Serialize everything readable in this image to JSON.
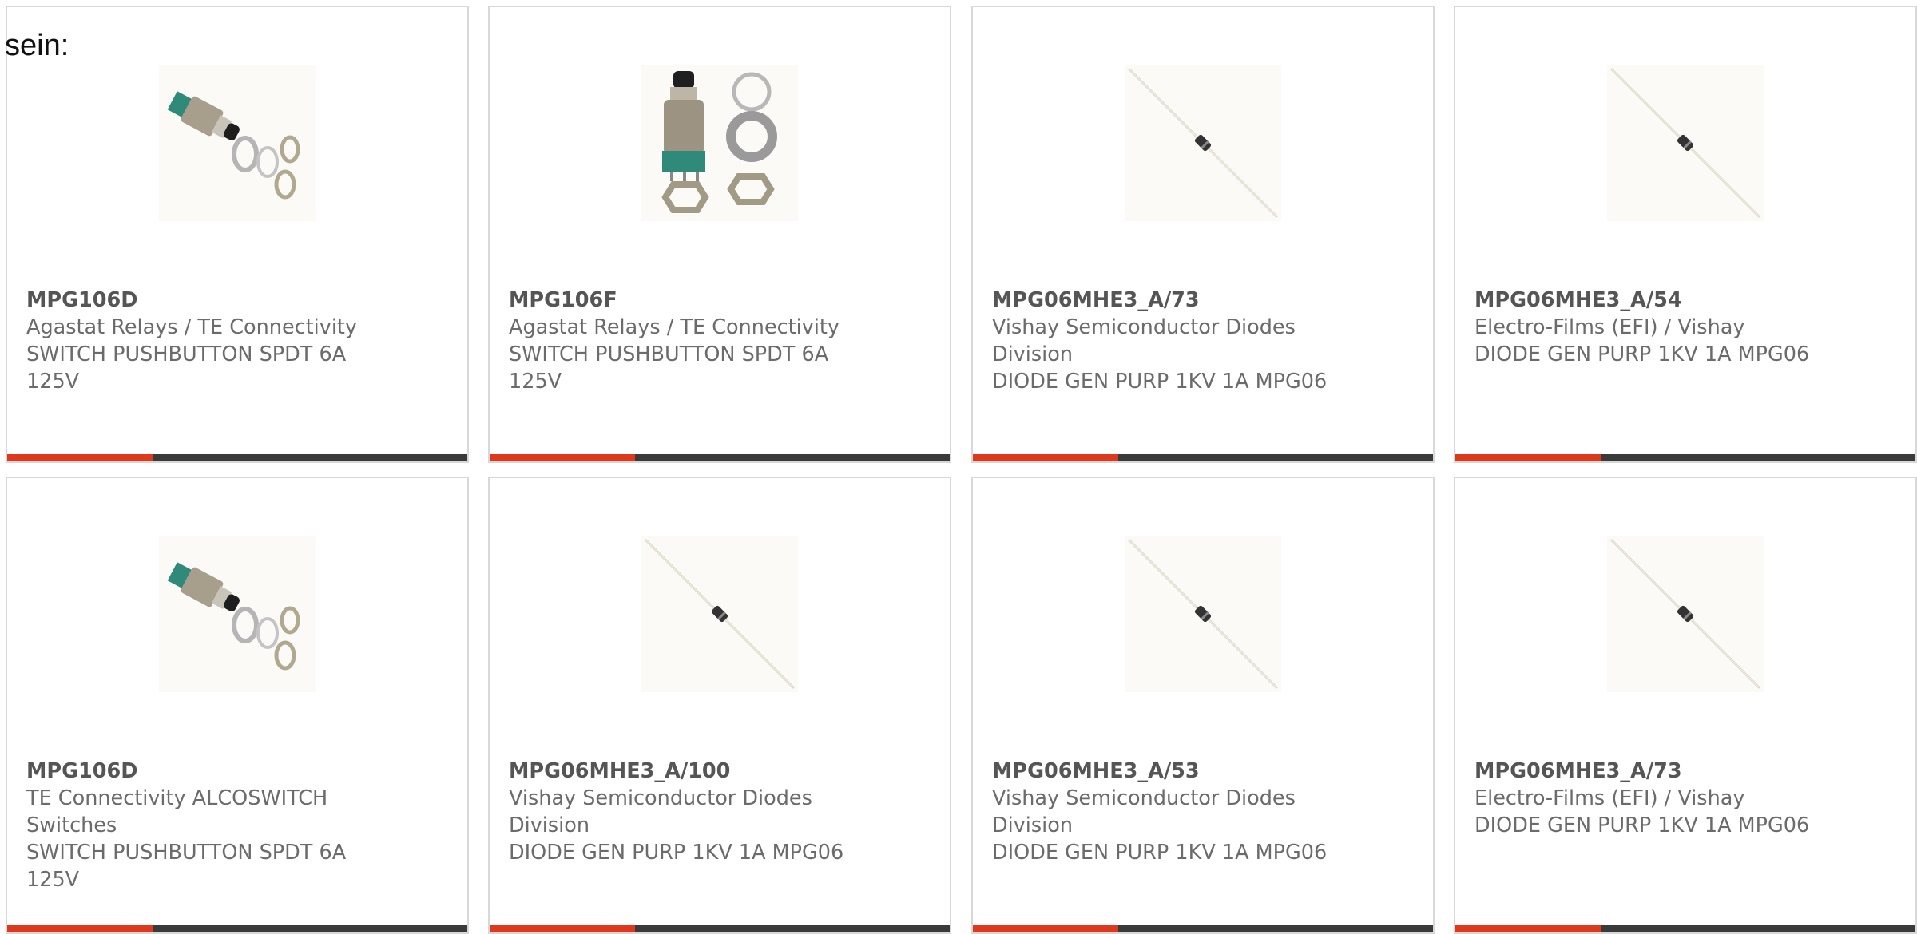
{
  "page": {
    "lead_text": "sein:"
  },
  "colors": {
    "accent": "#e0381c",
    "bar": "#3a3a3a",
    "border": "#d8d8d8",
    "text": "#6b6b6b"
  },
  "cards": [
    {
      "part": "MPG106D",
      "maker": "Agastat Relays / TE Connectivity",
      "maker2": "",
      "desc": "SWITCH PUSHBUTTON SPDT 6A",
      "desc2": "125V",
      "image": "pushbutton-switch-angled"
    },
    {
      "part": "MPG106F",
      "maker": "Agastat Relays / TE Connectivity",
      "maker2": "",
      "desc": "SWITCH PUSHBUTTON SPDT 6A",
      "desc2": "125V",
      "image": "pushbutton-switch-upright"
    },
    {
      "part": "MPG06MHE3_A/73",
      "maker": "Vishay Semiconductor Diodes",
      "maker2": "Division",
      "desc": "DIODE GEN PURP 1KV 1A MPG06",
      "desc2": "",
      "image": "axial-diode"
    },
    {
      "part": "MPG06MHE3_A/54",
      "maker": "Electro-Films (EFI) / Vishay",
      "maker2": "",
      "desc": "DIODE GEN PURP 1KV 1A MPG06",
      "desc2": "",
      "image": "axial-diode"
    },
    {
      "part": "MPG106D",
      "maker": "TE Connectivity ALCOSWITCH",
      "maker2": "Switches",
      "desc": "SWITCH PUSHBUTTON SPDT 6A",
      "desc2": "125V",
      "image": "pushbutton-switch-angled"
    },
    {
      "part": "MPG06MHE3_A/100",
      "maker": "Vishay Semiconductor Diodes",
      "maker2": "Division",
      "desc": "DIODE GEN PURP 1KV 1A MPG06",
      "desc2": "",
      "image": "axial-diode"
    },
    {
      "part": "MPG06MHE3_A/53",
      "maker": "Vishay Semiconductor Diodes",
      "maker2": "Division",
      "desc": "DIODE GEN PURP 1KV 1A MPG06",
      "desc2": "",
      "image": "axial-diode"
    },
    {
      "part": "MPG06MHE3_A/73",
      "maker": "Electro-Films (EFI) / Vishay",
      "maker2": "",
      "desc": "DIODE GEN PURP 1KV 1A MPG06",
      "desc2": "",
      "image": "axial-diode"
    }
  ]
}
